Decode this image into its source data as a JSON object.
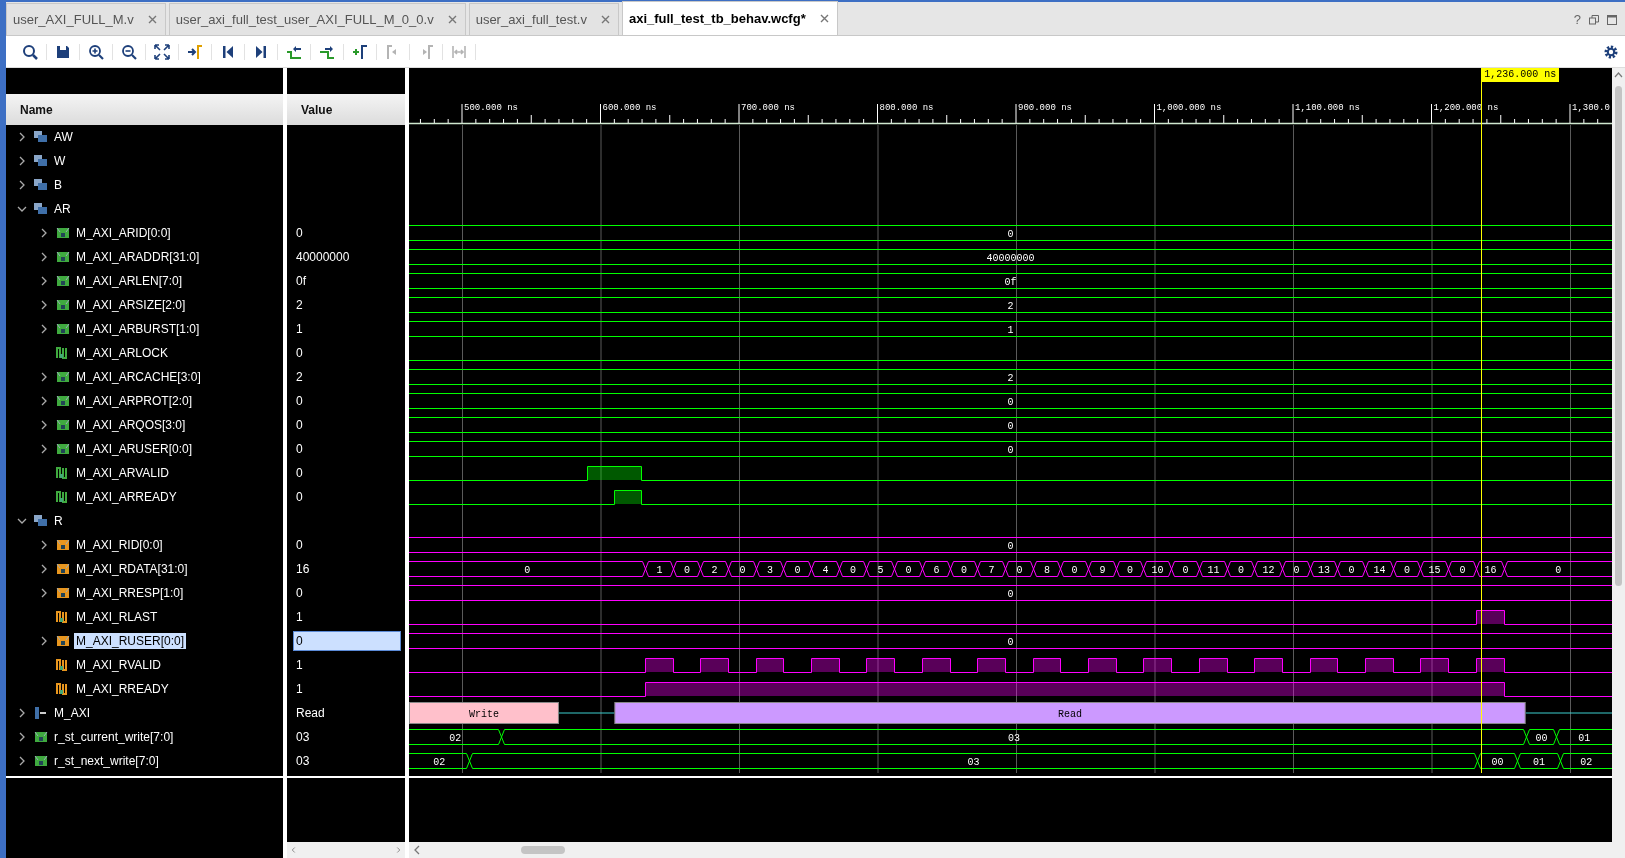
{
  "tabs": [
    {
      "label": "user_AXI_FULL_M.v",
      "selected": false
    },
    {
      "label": "user_axi_full_test_user_AXI_FULL_M_0_0.v",
      "selected": false
    },
    {
      "label": "user_axi_full_test.v",
      "selected": false
    },
    {
      "label": "axi_full_test_tb_behav.wcfg*",
      "selected": true
    }
  ],
  "help": "?",
  "toolbar": [
    {
      "kind": "search",
      "disabled": false
    },
    {
      "kind": "save",
      "disabled": false
    },
    {
      "kind": "zoom_in",
      "disabled": false
    },
    {
      "kind": "zoom_out",
      "disabled": false
    },
    {
      "kind": "zoom_fit",
      "disabled": false
    },
    {
      "kind": "go_to_cursor",
      "disabled": false
    },
    {
      "kind": "go_to_start",
      "disabled": false
    },
    {
      "kind": "go_to_end",
      "disabled": false
    },
    {
      "kind": "prev_transition",
      "disabled": false
    },
    {
      "kind": "next_transition",
      "disabled": false
    },
    {
      "kind": "add_marker",
      "disabled": false
    },
    {
      "kind": "prev_marker",
      "disabled": true
    },
    {
      "kind": "next_marker",
      "disabled": true
    },
    {
      "kind": "swap_cursors",
      "disabled": true
    }
  ],
  "columns": {
    "name": "Name",
    "value": "Value"
  },
  "ruler": {
    "ticks": [
      "500.000 ns",
      "600.000 ns",
      "700.000 ns",
      "800.000 ns",
      "900.000 ns",
      "1,000.000 ns",
      "1,100.000 ns",
      "1,200.000 ns",
      "1,300.0"
    ],
    "cursor": "1,236.000 ns"
  },
  "signals": [
    {
      "name": "AW",
      "kind": "group",
      "expanded": false,
      "selected": false
    },
    {
      "name": "W",
      "kind": "group",
      "expanded": false,
      "selected": false
    },
    {
      "name": "B",
      "kind": "group",
      "expanded": false,
      "selected": false
    },
    {
      "name": "AR",
      "kind": "group",
      "expanded": true,
      "selected": false,
      "children": [
        {
          "name": "M_AXI_ARID[0:0]",
          "kind": "bus",
          "expanded": false,
          "selected": false,
          "value": "0",
          "color": "#00ff00",
          "segments": [
            "0"
          ]
        },
        {
          "name": "M_AXI_ARADDR[31:0]",
          "kind": "bus",
          "expanded": false,
          "selected": false,
          "value": "40000000",
          "color": "#00ff00",
          "segments": [
            "40000000"
          ]
        },
        {
          "name": "M_AXI_ARLEN[7:0]",
          "kind": "bus",
          "expanded": false,
          "selected": false,
          "value": "0f",
          "color": "#00ff00",
          "segments": [
            "0f"
          ]
        },
        {
          "name": "M_AXI_ARSIZE[2:0]",
          "kind": "bus",
          "expanded": false,
          "selected": false,
          "value": "2",
          "color": "#00ff00",
          "segments": [
            "2"
          ]
        },
        {
          "name": "M_AXI_ARBURST[1:0]",
          "kind": "bus",
          "expanded": false,
          "selected": false,
          "value": "1",
          "color": "#00ff00",
          "segments": [
            "1"
          ]
        },
        {
          "name": "M_AXI_ARLOCK",
          "kind": "bit",
          "selected": false,
          "value": "0",
          "color": "#00ff00"
        },
        {
          "name": "M_AXI_ARCACHE[3:0]",
          "kind": "bus",
          "expanded": false,
          "selected": false,
          "value": "2",
          "color": "#00ff00",
          "segments": [
            "2"
          ]
        },
        {
          "name": "M_AXI_ARPROT[2:0]",
          "kind": "bus",
          "expanded": false,
          "selected": false,
          "value": "0",
          "color": "#00ff00",
          "segments": [
            "0"
          ]
        },
        {
          "name": "M_AXI_ARQOS[3:0]",
          "kind": "bus",
          "expanded": false,
          "selected": false,
          "value": "0",
          "color": "#00ff00",
          "segments": [
            "0"
          ]
        },
        {
          "name": "M_AXI_ARUSER[0:0]",
          "kind": "bus",
          "expanded": false,
          "selected": false,
          "value": "0",
          "color": "#00ff00",
          "segments": [
            "0"
          ]
        },
        {
          "name": "M_AXI_ARVALID",
          "kind": "bit",
          "selected": false,
          "value": "0",
          "color": "#00ff00"
        },
        {
          "name": "M_AXI_ARREADY",
          "kind": "bit",
          "selected": false,
          "value": "0",
          "color": "#00ff00"
        }
      ]
    },
    {
      "name": "R",
      "kind": "group",
      "expanded": true,
      "selected": false,
      "children": [
        {
          "name": "M_AXI_RID[0:0]",
          "kind": "bus",
          "expanded": false,
          "selected": false,
          "value": "0",
          "color": "#ff00ff",
          "segments": [
            "0"
          ]
        },
        {
          "name": "M_AXI_RDATA[31:0]",
          "kind": "bus",
          "expanded": false,
          "selected": false,
          "value": "16",
          "color": "#ff00ff",
          "segments": [
            "0",
            "1",
            "0",
            "2",
            "0",
            "3",
            "0",
            "4",
            "0",
            "5",
            "0",
            "6",
            "0",
            "7",
            "0",
            "8",
            "0",
            "9",
            "0",
            "10",
            "0",
            "11",
            "0",
            "12",
            "0",
            "13",
            "0",
            "14",
            "0",
            "15",
            "0",
            "16",
            "0"
          ]
        },
        {
          "name": "M_AXI_RRESP[1:0]",
          "kind": "bus",
          "expanded": false,
          "selected": false,
          "value": "0",
          "color": "#ff00ff",
          "segments": [
            "0"
          ]
        },
        {
          "name": "M_AXI_RLAST",
          "kind": "bit",
          "selected": false,
          "value": "1",
          "color": "#ff00ff"
        },
        {
          "name": "M_AXI_RUSER[0:0]",
          "kind": "bus",
          "expanded": false,
          "selected": true,
          "value": "0",
          "color": "#ff00ff",
          "segments": [
            "0"
          ]
        },
        {
          "name": "M_AXI_RVALID",
          "kind": "bit",
          "selected": false,
          "value": "1",
          "color": "#ff00ff"
        },
        {
          "name": "M_AXI_RREADY",
          "kind": "bit",
          "selected": false,
          "value": "1",
          "color": "#ff00ff"
        }
      ]
    },
    {
      "name": "M_AXI",
      "kind": "protocol",
      "expanded": false,
      "selected": false,
      "value": "Read",
      "segments": [
        {
          "label": "Write",
          "color": "#ffc0cb"
        },
        {
          "label": "Read",
          "color": "#cc99ff"
        }
      ]
    },
    {
      "name": "r_st_current_write[7:0]",
      "kind": "bus",
      "expanded": false,
      "selected": false,
      "value": "03",
      "color": "#00ff00",
      "segments": [
        "02",
        "03",
        "00",
        "01"
      ]
    },
    {
      "name": "r_st_next_write[7:0]",
      "kind": "bus",
      "expanded": false,
      "selected": false,
      "value": "03",
      "color": "#00ff00",
      "segments": [
        "02",
        "03",
        "00",
        "01",
        "02"
      ]
    }
  ]
}
